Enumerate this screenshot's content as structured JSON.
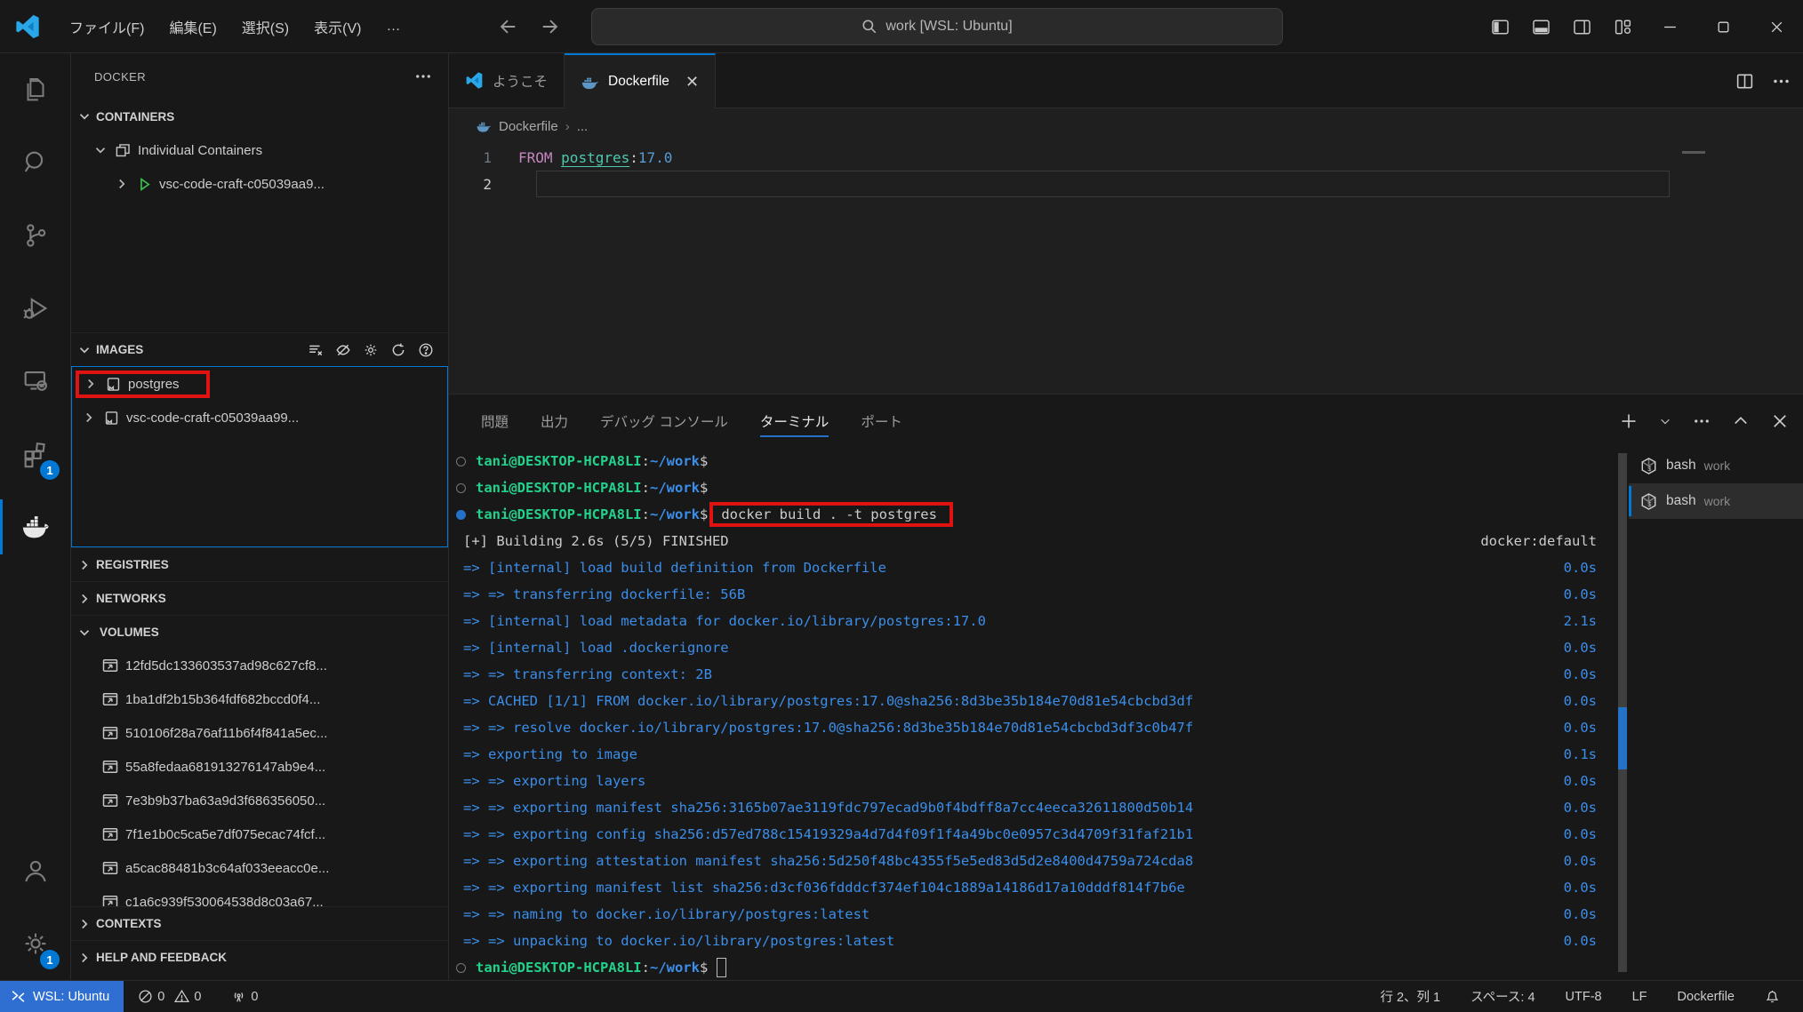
{
  "colors": {
    "accent": "#0078d4",
    "annotation_red": "#e01212",
    "remote_bg": "#2e6fd1",
    "ansi_green": "#23d18b",
    "ansi_blue": "#3b8eea",
    "keyword": "#c586c0",
    "tag_blue": "#569cd6"
  },
  "titlebar": {
    "menu_items": [
      "ファイル(F)",
      "編集(E)",
      "選択(S)",
      "表示(V)",
      "…"
    ],
    "search_text": "work [WSL: Ubuntu]"
  },
  "activity_bar": {
    "extensions_badge": "1",
    "settings_badge": "1"
  },
  "sidebar": {
    "title": "DOCKER",
    "containers": {
      "header": "CONTAINERS",
      "group_label": "Individual Containers",
      "container_label": "vsc-code-craft-c05039aa9..."
    },
    "images": {
      "header": "IMAGES",
      "items": [
        {
          "label": "postgres"
        },
        {
          "label": "vsc-code-craft-c05039aa99..."
        }
      ]
    },
    "registries_header": "REGISTRIES",
    "networks_header": "NETWORKS",
    "volumes": {
      "header": "VOLUMES",
      "items": [
        {
          "label": "12fd5dc133603537ad98c627cf8..."
        },
        {
          "label": "1ba1df2b15b364fdf682bccd0f4..."
        },
        {
          "label": "510106f28a76af11b6f4f841a5ec..."
        },
        {
          "label": "55a8fedaa681913276147ab9e4..."
        },
        {
          "label": "7e3b9b37ba63a9d3f686356050..."
        },
        {
          "label": "7f1e1b0c5ca5e7df075ecac74fcf..."
        },
        {
          "label": "a5cac88481b3c64af033eeacc0e..."
        },
        {
          "label": "c1a6c939f530064538d8c03a67..."
        }
      ]
    },
    "contexts_header": "CONTEXTS",
    "help_header": "HELP AND FEEDBACK"
  },
  "editor": {
    "tabs": {
      "welcome": "ようこそ",
      "active_file": "Dockerfile"
    },
    "breadcrumb": {
      "file": "Dockerfile",
      "more": "..."
    },
    "line_numbers": {
      "l1": "1",
      "l2": "2"
    },
    "code": {
      "keyword": "FROM",
      "image": "postgres",
      "colon": ":",
      "tag": "17.0"
    }
  },
  "panel": {
    "tabs": {
      "problems": "問題",
      "output": "出力",
      "debug_console": "デバッグ コンソール",
      "terminal": "ターミナル",
      "ports": "ポート"
    }
  },
  "terminal": {
    "prompt": {
      "user": "tani@DESKTOP-HCPA8LI",
      "colon": ":",
      "path": "~/work",
      "dollar": "$"
    },
    "command": "docker build . -t postgres",
    "building_line": {
      "text": "[+] Building 2.6s (5/5) FINISHED",
      "right": "docker:default"
    },
    "build_steps": [
      {
        "text": "=> [internal] load build definition from Dockerfile",
        "time": "0.0s"
      },
      {
        "text": "=> => transferring dockerfile: 56B",
        "time": "0.0s"
      },
      {
        "text": "=> [internal] load metadata for docker.io/library/postgres:17.0",
        "time": "2.1s"
      },
      {
        "text": "=> [internal] load .dockerignore",
        "time": "0.0s"
      },
      {
        "text": "=> => transferring context: 2B",
        "time": "0.0s"
      },
      {
        "text": "=> CACHED [1/1] FROM docker.io/library/postgres:17.0@sha256:8d3be35b184e70d81e54cbcbd3df",
        "time": "0.0s"
      },
      {
        "text": "=> => resolve docker.io/library/postgres:17.0@sha256:8d3be35b184e70d81e54cbcbd3df3c0b47f",
        "time": "0.0s"
      },
      {
        "text": "=> exporting to image",
        "time": "0.1s"
      },
      {
        "text": "=> => exporting layers",
        "time": "0.0s"
      },
      {
        "text": "=> => exporting manifest sha256:3165b07ae3119fdc797ecad9b0f4bdff8a7cc4eeca32611800d50b14",
        "time": "0.0s"
      },
      {
        "text": "=> => exporting config sha256:d57ed788c15419329a4d7d4f09f1f4a49bc0e0957c3d4709f31faf21b1",
        "time": "0.0s"
      },
      {
        "text": "=> => exporting attestation manifest sha256:5d250f48bc4355f5e5ed83d5d2e8400d4759a724cda8",
        "time": "0.0s"
      },
      {
        "text": "=> => exporting manifest list sha256:d3cf036fdddcf374ef104c1889a14186d17a10dddf814f7b6e",
        "time": "0.0s"
      },
      {
        "text": "=> => naming to docker.io/library/postgres:latest",
        "time": "0.0s"
      },
      {
        "text": "=> => unpacking to docker.io/library/postgres:latest",
        "time": "0.0s"
      }
    ],
    "sessions": [
      {
        "name": "bash",
        "detail": "work"
      },
      {
        "name": "bash",
        "detail": "work"
      }
    ]
  },
  "status_bar": {
    "remote": "WSL: Ubuntu",
    "errors": "0",
    "warnings": "0",
    "ports": "0",
    "cursor_position": "行 2、列 1",
    "indentation": "スペース: 4",
    "encoding": "UTF-8",
    "eol": "LF",
    "language": "Dockerfile"
  }
}
